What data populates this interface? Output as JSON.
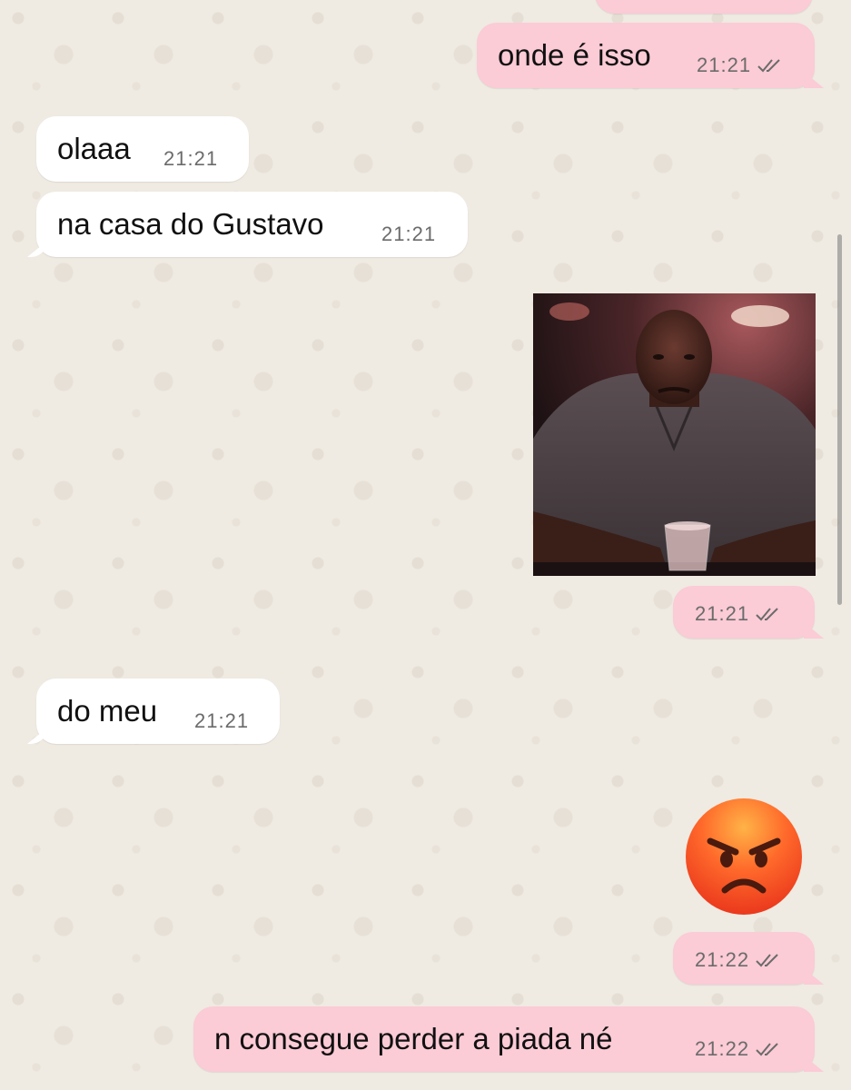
{
  "colors": {
    "background": "#efeae2",
    "outgoing_bubble": "#fbcbd6",
    "incoming_bubble": "#ffffff",
    "timestamp": "#6b6b6b",
    "text": "#111111"
  },
  "messages": [
    {
      "direction": "outgoing",
      "text": "onde é isso",
      "time": "21:21",
      "status": "read"
    },
    {
      "direction": "incoming",
      "text": "olaaa",
      "time": "21:21"
    },
    {
      "direction": "incoming",
      "text": "na casa do Gustavo",
      "time": "21:21"
    },
    {
      "direction": "outgoing",
      "type": "image",
      "image": "photo-man-holding-plastic-cup",
      "time": "21:21",
      "status": "read"
    },
    {
      "direction": "incoming",
      "text": "do meu",
      "time": "21:21"
    },
    {
      "direction": "outgoing",
      "type": "emoji",
      "emoji": "angry-face-emoji",
      "time": "21:22",
      "status": "read"
    },
    {
      "direction": "outgoing",
      "text": "n consegue perder a piada né",
      "time": "21:22",
      "status": "read"
    }
  ],
  "icons": {
    "read_receipt": "double-check-icon",
    "emoji": "angry-face-emoji"
  }
}
